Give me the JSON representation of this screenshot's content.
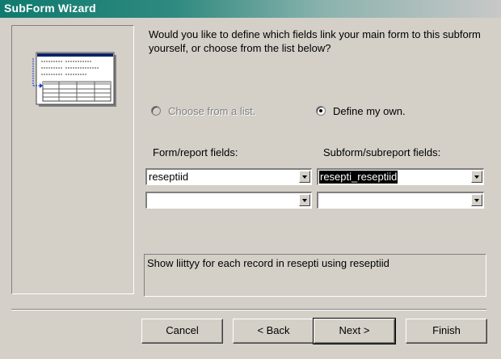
{
  "window": {
    "title": "SubForm Wizard"
  },
  "prompt": "Would you like to define which fields link your main form to this subform yourself, or choose from the list below?",
  "options": {
    "choose_from_list": "Choose from a list.",
    "define_my_own": "Define my own.",
    "selected": "define_my_own"
  },
  "columns": {
    "form_fields_label": "Form/report fields:",
    "subform_fields_label": "Subform/subreport fields:"
  },
  "links": [
    {
      "form_field": "reseptiid",
      "subform_field": "resepti_reseptiid"
    },
    {
      "form_field": "",
      "subform_field": ""
    }
  ],
  "info_text": "Show liittyy for each record in resepti using reseptiid",
  "buttons": {
    "cancel": "Cancel",
    "back": "< Back",
    "next": "Next >",
    "finish": "Finish"
  },
  "colors": {
    "titlebar_start": "#0f7a6e",
    "face": "#d4d0c8",
    "preview_header": "#0a246a"
  }
}
